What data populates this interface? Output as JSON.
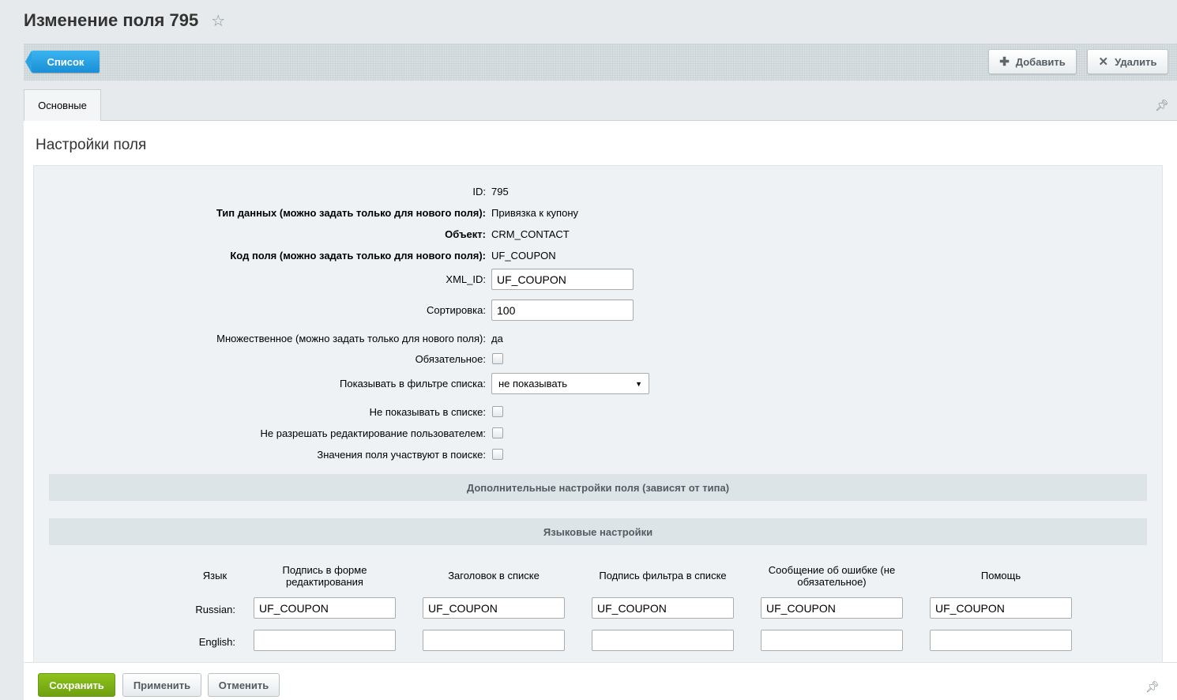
{
  "page": {
    "title": "Изменение поля 795"
  },
  "toolbar": {
    "list_label": "Список",
    "add_label": "Добавить",
    "delete_label": "Удалить"
  },
  "tabs": [
    {
      "label": "Основные"
    }
  ],
  "section": {
    "title": "Настройки поля"
  },
  "fields": {
    "id": {
      "label": "ID:",
      "value": "795"
    },
    "type": {
      "label": "Тип данных (можно задать только для нового поля):",
      "value": "Привязка к купону"
    },
    "object": {
      "label": "Объект:",
      "value": "CRM_CONTACT"
    },
    "code": {
      "label": "Код поля (можно задать только для нового поля):",
      "value": "UF_COUPON"
    },
    "xml_id": {
      "label": "XML_ID:",
      "value": "UF_COUPON"
    },
    "sort": {
      "label": "Сортировка:",
      "value": "100"
    },
    "multiple": {
      "label": "Множественное (можно задать только для нового поля):",
      "value": "да"
    },
    "mandatory": {
      "label": "Обязательное:"
    },
    "show_filter": {
      "label": "Показывать в фильтре списка:",
      "value": "не показывать"
    },
    "hide_in_list": {
      "label": "Не показывать в списке:"
    },
    "no_edit": {
      "label": "Не разрешать редактирование пользователем:"
    },
    "searchable": {
      "label": "Значения поля участвуют в поиске:"
    }
  },
  "bands": {
    "extra": "Дополнительные настройки поля (зависят от типа)",
    "lang": "Языковые настройки"
  },
  "lang_table": {
    "headers": {
      "lang": "Язык",
      "edit_form": "Подпись в форме редактирования",
      "list_column": "Заголовок в списке",
      "list_filter": "Подпись фильтра в списке",
      "error_message": "Сообщение об ошибке (не обязательное)",
      "help": "Помощь"
    },
    "rows": [
      {
        "lang": "Russian:",
        "edit_form": "UF_COUPON",
        "list_column": "UF_COUPON",
        "list_filter": "UF_COUPON",
        "error_message": "UF_COUPON",
        "help": "UF_COUPON"
      },
      {
        "lang": "English:",
        "edit_form": "",
        "list_column": "",
        "list_filter": "",
        "error_message": "",
        "help": ""
      }
    ]
  },
  "footer": {
    "save_label": "Сохранить",
    "apply_label": "Применить",
    "cancel_label": "Отменить"
  }
}
